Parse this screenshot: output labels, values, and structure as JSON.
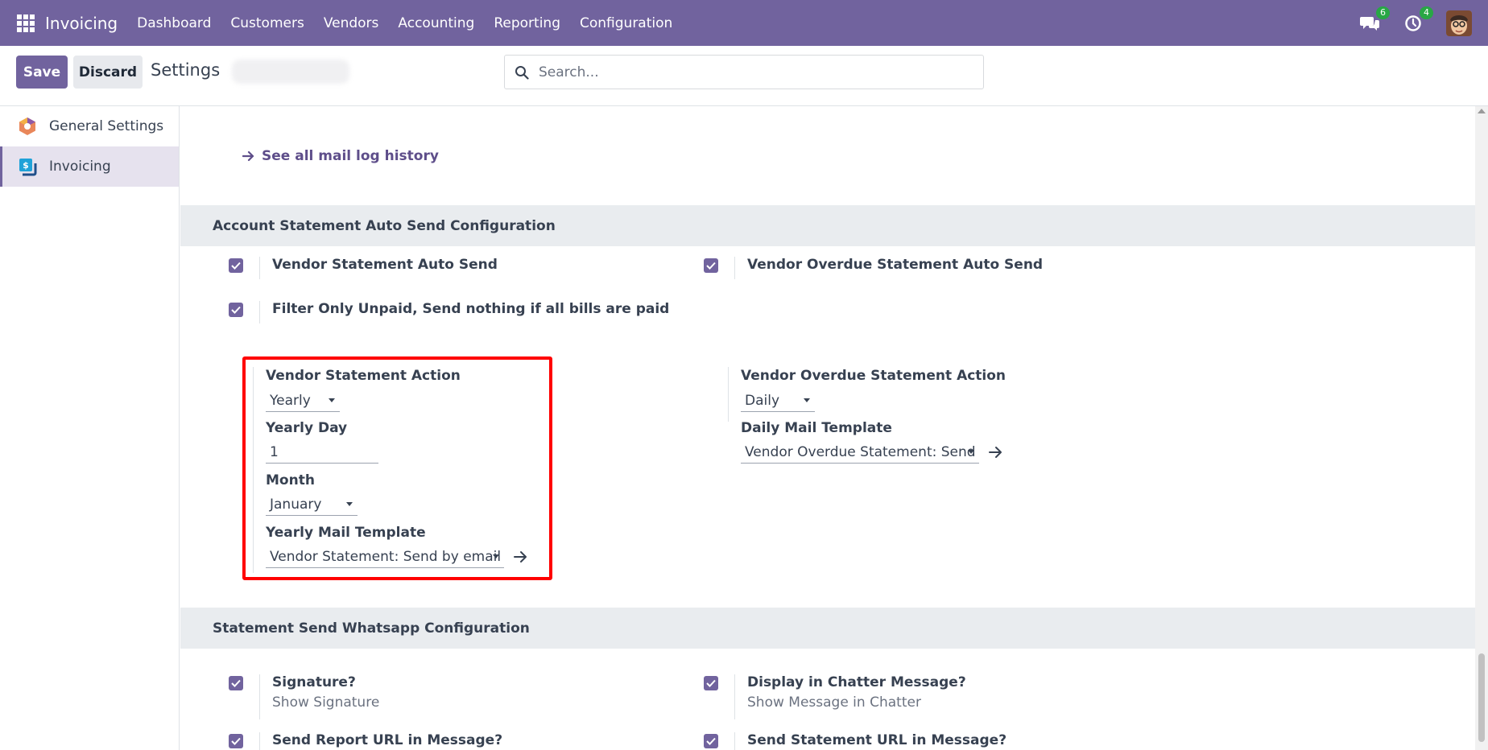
{
  "navbar": {
    "app_title": "Invoicing",
    "menu": [
      "Dashboard",
      "Customers",
      "Vendors",
      "Accounting",
      "Reporting",
      "Configuration"
    ],
    "messages_count": "6",
    "activities_count": "4",
    "bg_color": "#71639e"
  },
  "controlbar": {
    "save_label": "Save",
    "discard_label": "Discard",
    "breadcrumb": "Settings",
    "search_placeholder": "Search..."
  },
  "sidebar": {
    "items": [
      {
        "label": "General Settings",
        "icon": "general-settings-icon",
        "active": false
      },
      {
        "label": "Invoicing",
        "icon": "invoicing-app-icon",
        "active": true
      }
    ]
  },
  "main": {
    "mail_log_link": "See all mail log history",
    "auto_send": {
      "title": "Account Statement Auto Send Configuration",
      "vendor_auto_send": {
        "label": "Vendor Statement Auto Send",
        "checked": true
      },
      "vendor_overdue_auto_send": {
        "label": "Vendor Overdue Statement Auto Send",
        "checked": true
      },
      "filter_unpaid": {
        "label": "Filter Only Unpaid, Send nothing if all bills are paid",
        "checked": true
      },
      "vendor_action": {
        "label": "Vendor Statement Action",
        "value": "Yearly",
        "yearly_day_label": "Yearly Day",
        "yearly_day_value": "1",
        "month_label": "Month",
        "month_value": "January",
        "template_label": "Yearly Mail Template",
        "template_value": "Vendor Statement: Send by email"
      },
      "overdue_action": {
        "label": "Vendor Overdue Statement Action",
        "value": "Daily",
        "template_label": "Daily Mail Template",
        "template_value": "Vendor Overdue Statement: Send by email"
      }
    },
    "whatsapp": {
      "title": "Statement Send Whatsapp Configuration",
      "signature": {
        "label": "Signature?",
        "sub": "Show Signature",
        "checked": true
      },
      "chatter": {
        "label": "Display in Chatter Message?",
        "sub": "Show Message in Chatter",
        "checked": true
      },
      "report_url": {
        "label": "Send Report URL in Message?",
        "checked": true
      },
      "statement_url": {
        "label": "Send Statement URL in Message?",
        "checked": true
      }
    }
  }
}
